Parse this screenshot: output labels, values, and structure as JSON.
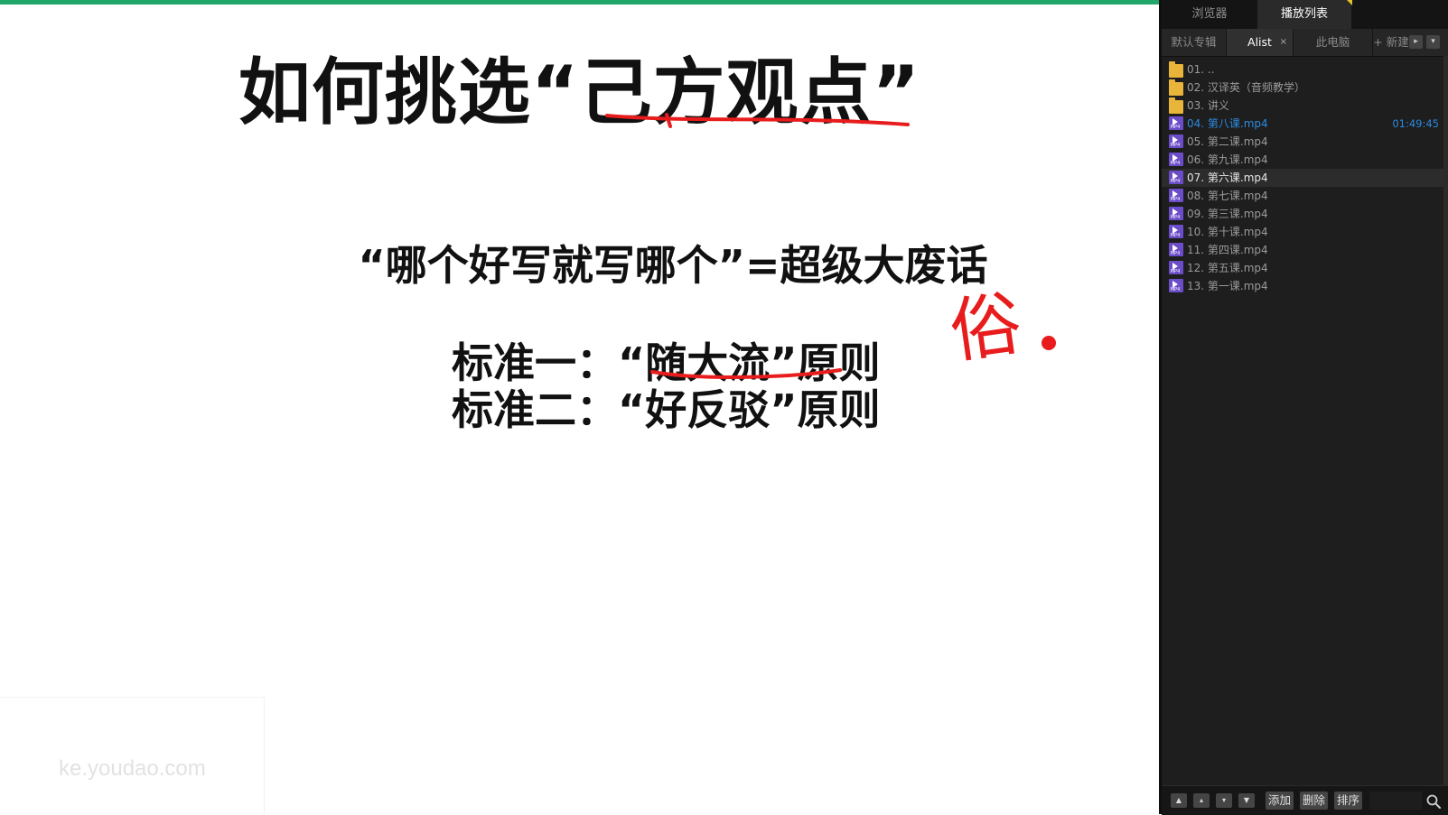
{
  "slide": {
    "title": "如何挑选“己方观点”",
    "line1": "“哪个好写就写哪个”=超级大废话",
    "standard1": "标准一：“随大流”原则",
    "standard2": "标准二：“好反驳”原则",
    "handwriting": "俗",
    "watermark": "ke.youdao.com"
  },
  "panel": {
    "tabs": [
      "浏览器",
      "播放列表"
    ],
    "album_tabs": {
      "default": "默认专辑",
      "alist": "Alist",
      "alist_close": "×",
      "pc": "此电脑",
      "new": "+ 新建"
    },
    "items": [
      {
        "label": "01. ..",
        "type": "folder"
      },
      {
        "label": "02. 汉译英（音频教学）",
        "type": "folder"
      },
      {
        "label": "03. 讲义",
        "type": "folder"
      },
      {
        "label": "04. 第八课.mp4",
        "type": "mp4",
        "state": "playing",
        "duration": "01:49:45"
      },
      {
        "label": "05. 第二课.mp4",
        "type": "mp4"
      },
      {
        "label": "06. 第九课.mp4",
        "type": "mp4"
      },
      {
        "label": "07. 第六课.mp4",
        "type": "mp4",
        "state": "highlighted"
      },
      {
        "label": "08. 第七课.mp4",
        "type": "mp4"
      },
      {
        "label": "09. 第三课.mp4",
        "type": "mp4"
      },
      {
        "label": "10. 第十课.mp4",
        "type": "mp4"
      },
      {
        "label": "11. 第四课.mp4",
        "type": "mp4"
      },
      {
        "label": "12. 第五课.mp4",
        "type": "mp4"
      },
      {
        "label": "13. 第一课.mp4",
        "type": "mp4"
      }
    ],
    "toolbar": {
      "add": "添加",
      "delete": "删除",
      "sort": "排序"
    }
  },
  "colors": {
    "accent_bar": "#21a66a",
    "ink": "#e81c1c",
    "playing": "#2b8ae0"
  }
}
